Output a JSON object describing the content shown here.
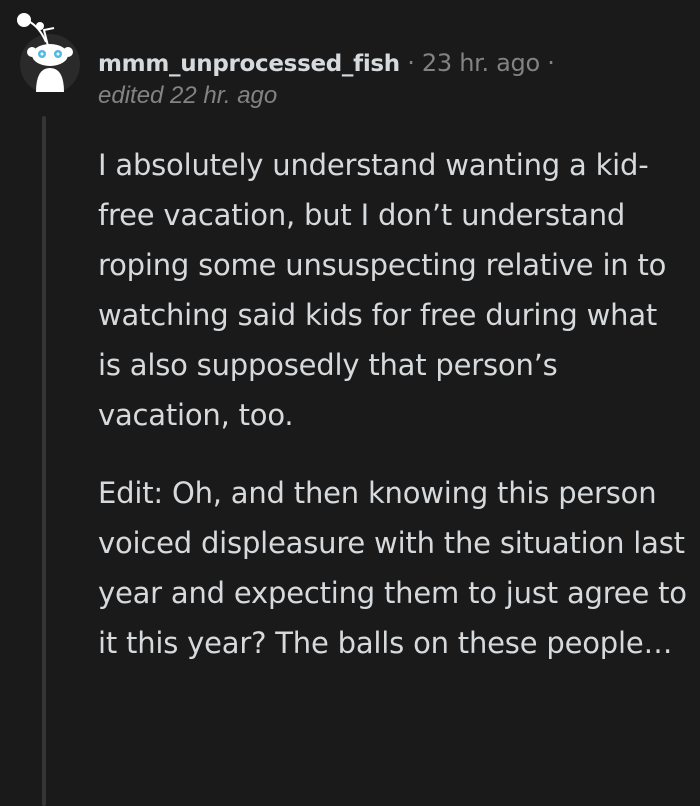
{
  "comment": {
    "author": "mmm_unprocessed_fish",
    "separator": "·",
    "posted": "23 hr. ago",
    "edited": "edited 22 hr. ago",
    "paragraphs": [
      "I absolutely understand wanting a kid-free vacation, but I don’t understand roping some unsuspecting relative in to watching said kids for free during what is also supposedly that person’s vacation, too.",
      "Edit: Oh, and then knowing this person voiced displeasure with the situation last year and expecting them to just agree to it this year? The balls on these people…"
    ]
  },
  "colors": {
    "background": "#1a1a1b",
    "text": "#d7dadc",
    "meta": "#818384",
    "thread_line": "#343536",
    "avatar_bg": "#2a2a2b",
    "avatar_eye": "#4fb8e6"
  },
  "icons": {
    "avatar": "snoo-avatar-icon"
  }
}
